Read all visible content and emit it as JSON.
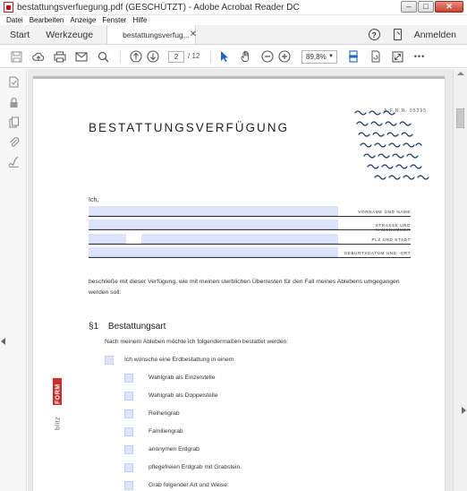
{
  "window": {
    "title": "bestattungsverfuegung.pdf (GESCHÜTZT) - Adobe Acrobat Reader DC",
    "controls": {
      "minimize": "–",
      "maximize": "□",
      "close": "✕"
    }
  },
  "menu": [
    "Datei",
    "Bearbeiten",
    "Anzeige",
    "Fenster",
    "Hilfe"
  ],
  "tabs": {
    "home": "Start",
    "tools": "Werkzeuge",
    "document": "bestattungsverfug...",
    "close": "✕",
    "help": "?",
    "signin": "Anmelden"
  },
  "toolbar": {
    "page_current": "2",
    "page_total": "/  12",
    "zoom": "89,8%",
    "more": "•••"
  },
  "document": {
    "doc_number": "A.F.N.R. 05395",
    "title": "BESTATTUNGSVERFÜGUNG",
    "ich": "Ich,",
    "fields": [
      "VORNAME UND NAME",
      "STRASSE UND HAUSNUMMER",
      "PLZ UND STADT",
      "GEBURTSDATUM UND -ORT"
    ],
    "intro": "beschließe mit dieser Verfügung, wie mit meinen sterblichen Überresten für den Fall meines Ablebens umgegangen werden soll:",
    "section_number": "§1",
    "section_title": "Bestattungsart",
    "section_intro": "Nach meinem Ableben möchte ich folgendermaßen bestattet werden:",
    "main_option": "Ich wünsche eine Erdbestattung in einem",
    "options": [
      "Wahlgrab als Einzelstelle",
      "Wahlgrab als Doppelstelle",
      "Reihengrab",
      "Familiengrab",
      "anonymen Erdgrab",
      "pflegefreien Erdgrab mit Grabstein.",
      "Grab folgender Art und Weise:"
    ],
    "brand": "FORMblitz"
  }
}
